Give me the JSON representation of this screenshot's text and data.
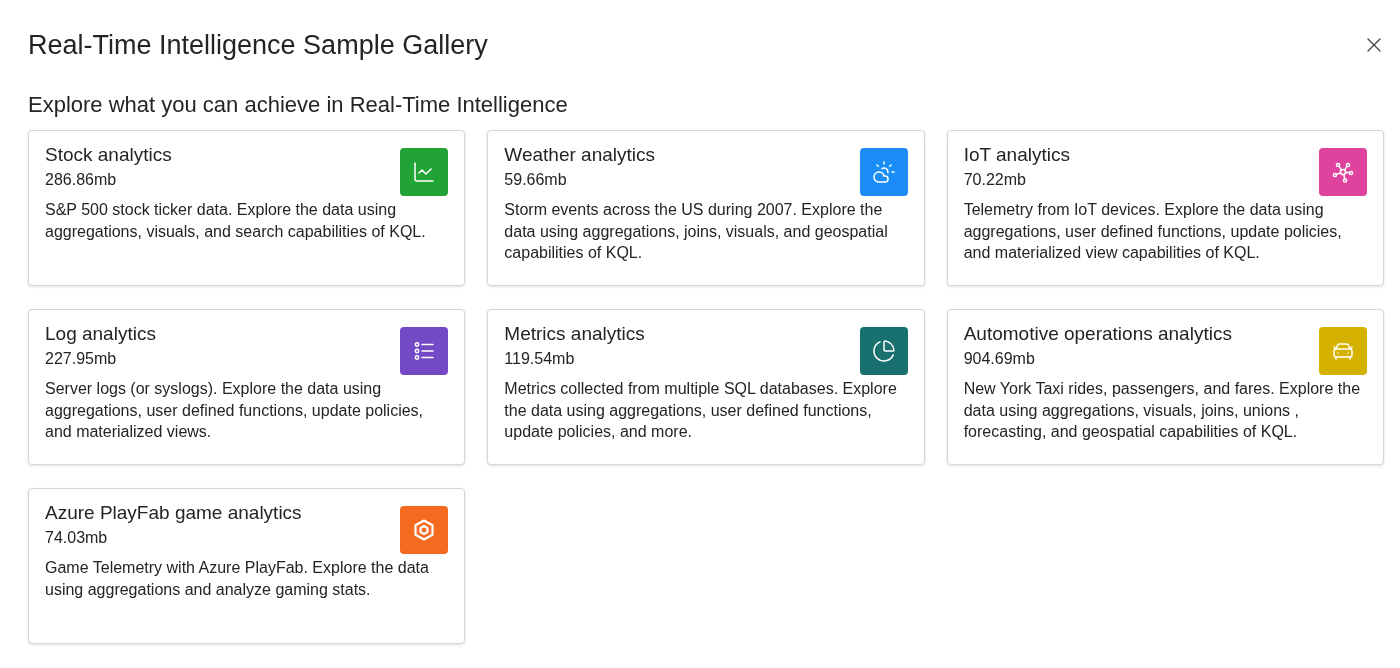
{
  "dialog": {
    "title": "Real-Time Intelligence Sample Gallery",
    "subtitle": "Explore what you can achieve in Real-Time Intelligence",
    "samples": [
      {
        "title": "Stock analytics",
        "size": "286.86mb",
        "description": "S&P 500 stock ticker data. Explore the data using aggregations, visuals, and search capabilities of KQL.",
        "color": "#21a336"
      },
      {
        "title": "Weather analytics",
        "size": "59.66mb",
        "description": "Storm events across the US during 2007. Explore the data using aggregations, joins, visuals, and geospatial capabilities of KQL.",
        "color": "#1a8cf5"
      },
      {
        "title": "IoT analytics",
        "size": "70.22mb",
        "description": "Telemetry from IoT devices. Explore the data using aggregations, user defined functions, update policies, and materialized view capabilities of KQL.",
        "color": "#e0439d"
      },
      {
        "title": "Log analytics",
        "size": "227.95mb",
        "description": "Server logs (or syslogs). Explore the data using aggregations, user defined functions, update policies, and materialized views.",
        "color": "#7449c6"
      },
      {
        "title": "Metrics analytics",
        "size": "119.54mb",
        "description": "Metrics collected from multiple SQL databases. Explore the data using aggregations, user defined functions, update policies, and more.",
        "color": "#18706f"
      },
      {
        "title": "Automotive operations analytics",
        "size": "904.69mb",
        "description": "New York Taxi rides, passengers, and fares. Explore the data using aggregations, visuals, joins, unions , forecasting, and geospatial capabilities of KQL.",
        "color": "#d5b200"
      },
      {
        "title": "Azure PlayFab game analytics",
        "size": "74.03mb",
        "description": "Game Telemetry with Azure PlayFab. Explore the data using aggregations and analyze gaming stats.",
        "color": "#f46a1f"
      }
    ]
  }
}
